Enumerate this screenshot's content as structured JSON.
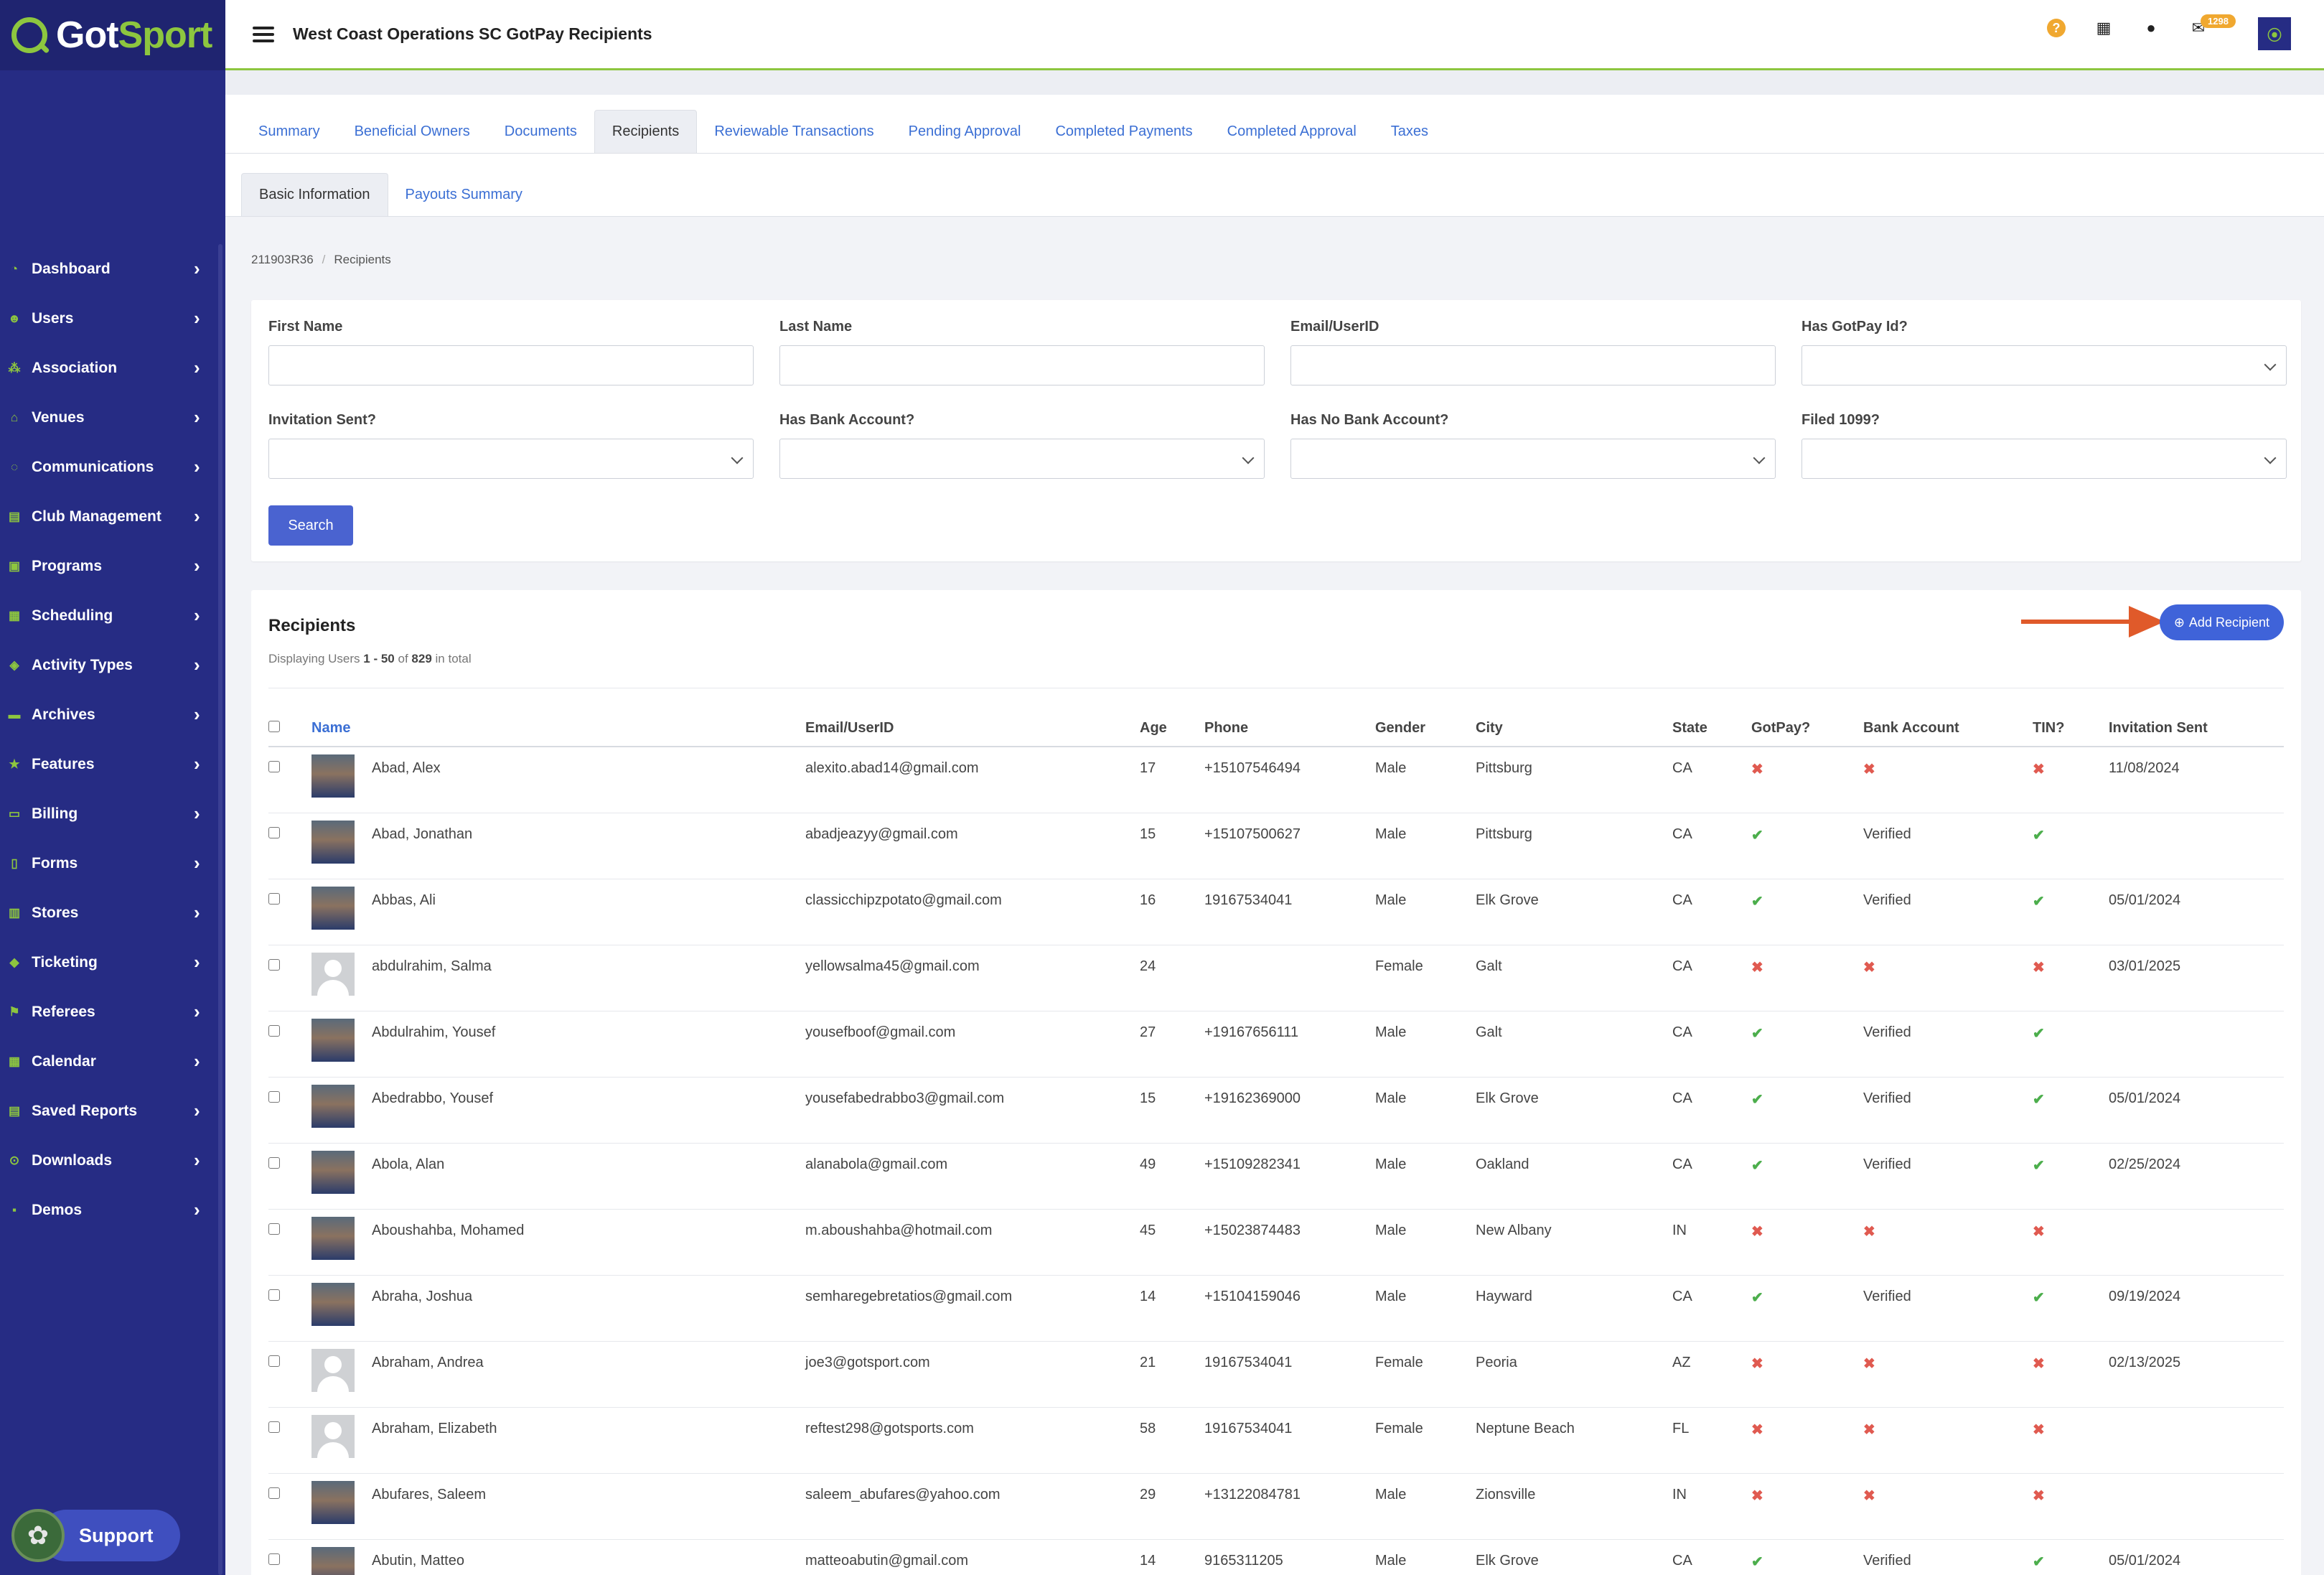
{
  "brand": {
    "got": "Got",
    "sport": "Sport"
  },
  "header": {
    "title": "West Coast Operations SC GotPay Recipients",
    "mail_count": "1298"
  },
  "sidebar": {
    "items": [
      {
        "label": "Dashboard",
        "icon": "dashboard-icon"
      },
      {
        "label": "Users",
        "icon": "users-icon"
      },
      {
        "label": "Association",
        "icon": "association-icon"
      },
      {
        "label": "Venues",
        "icon": "venues-icon"
      },
      {
        "label": "Communications",
        "icon": "communications-icon"
      },
      {
        "label": "Club Management",
        "icon": "club-management-icon"
      },
      {
        "label": "Programs",
        "icon": "programs-icon"
      },
      {
        "label": "Scheduling",
        "icon": "scheduling-icon"
      },
      {
        "label": "Activity Types",
        "icon": "activity-types-icon"
      },
      {
        "label": "Archives",
        "icon": "archives-icon"
      },
      {
        "label": "Features",
        "icon": "features-icon"
      },
      {
        "label": "Billing",
        "icon": "billing-icon"
      },
      {
        "label": "Forms",
        "icon": "forms-icon"
      },
      {
        "label": "Stores",
        "icon": "stores-icon"
      },
      {
        "label": "Ticketing",
        "icon": "ticketing-icon"
      },
      {
        "label": "Referees",
        "icon": "referees-icon"
      },
      {
        "label": "Calendar",
        "icon": "calendar-icon"
      },
      {
        "label": "Saved Reports",
        "icon": "saved-reports-icon"
      },
      {
        "label": "Downloads",
        "icon": "downloads-icon"
      },
      {
        "label": "Demos",
        "icon": "demos-icon"
      }
    ],
    "support_label": "Support"
  },
  "tabs": [
    "Summary",
    "Beneficial Owners",
    "Documents",
    "Recipients",
    "Reviewable Transactions",
    "Pending Approval",
    "Completed Payments",
    "Completed Approval",
    "Taxes"
  ],
  "active_tab": "Recipients",
  "subtabs": [
    "Basic Information",
    "Payouts Summary"
  ],
  "breadcrumb": {
    "code": "211903R36",
    "current": "Recipients"
  },
  "filters": {
    "first_name": {
      "label": "First Name",
      "value": ""
    },
    "last_name": {
      "label": "Last Name",
      "value": ""
    },
    "email": {
      "label": "Email/UserID",
      "value": ""
    },
    "has_gotpay": {
      "label": "Has GotPay Id?",
      "value": ""
    },
    "invitation_sent": {
      "label": "Invitation Sent?",
      "value": ""
    },
    "has_bank": {
      "label": "Has Bank Account?",
      "value": ""
    },
    "has_no_bank": {
      "label": "Has No Bank Account?",
      "value": ""
    },
    "filed_1099": {
      "label": "Filed 1099?",
      "value": ""
    },
    "search_label": "Search"
  },
  "recipients": {
    "title": "Recipients",
    "display_prefix": "Displaying Users",
    "range": "1 - 50",
    "of": "of",
    "total": "829",
    "suffix": "in total",
    "add_label": "Add Recipient",
    "columns": [
      "Name",
      "Email/UserID",
      "Age",
      "Phone",
      "Gender",
      "City",
      "State",
      "GotPay?",
      "Bank Account",
      "TIN?",
      "Invitation Sent"
    ],
    "rows": [
      {
        "name": "Abad, Alex",
        "email": "alexito.abad14@gmail.com",
        "age": "17",
        "phone": "+15107546494",
        "gender": "Male",
        "city": "Pittsburg",
        "state": "CA",
        "gotpay": false,
        "bank": "",
        "tin": false,
        "invited": "11/08/2024",
        "photo": true
      },
      {
        "name": "Abad, Jonathan",
        "email": "abadjeazyy@gmail.com",
        "age": "15",
        "phone": "+15107500627",
        "gender": "Male",
        "city": "Pittsburg",
        "state": "CA",
        "gotpay": true,
        "bank": "Verified",
        "tin": true,
        "invited": "",
        "photo": true
      },
      {
        "name": "Abbas, Ali",
        "email": "classicchipzpotato@gmail.com",
        "age": "16",
        "phone": "19167534041",
        "gender": "Male",
        "city": "Elk Grove",
        "state": "CA",
        "gotpay": true,
        "bank": "Verified",
        "tin": true,
        "invited": "05/01/2024",
        "photo": true
      },
      {
        "name": "abdulrahim, Salma",
        "email": "yellowsalma45@gmail.com",
        "age": "24",
        "phone": "",
        "gender": "Female",
        "city": "Galt",
        "state": "CA",
        "gotpay": false,
        "bank": "",
        "tin": false,
        "invited": "03/01/2025",
        "photo": false
      },
      {
        "name": "Abdulrahim, Yousef",
        "email": "yousefboof@gmail.com",
        "age": "27",
        "phone": "+19167656111",
        "gender": "Male",
        "city": "Galt",
        "state": "CA",
        "gotpay": true,
        "bank": "Verified",
        "tin": true,
        "invited": "",
        "photo": true
      },
      {
        "name": "Abedrabbo, Yousef",
        "email": "yousefabedrabbo3@gmail.com",
        "age": "15",
        "phone": "+19162369000",
        "gender": "Male",
        "city": "Elk Grove",
        "state": "CA",
        "gotpay": true,
        "bank": "Verified",
        "tin": true,
        "invited": "05/01/2024",
        "photo": true
      },
      {
        "name": "Abola, Alan",
        "email": "alanabola@gmail.com",
        "age": "49",
        "phone": "+15109282341",
        "gender": "Male",
        "city": "Oakland",
        "state": "CA",
        "gotpay": true,
        "bank": "Verified",
        "tin": true,
        "invited": "02/25/2024",
        "photo": true
      },
      {
        "name": "Aboushahba, Mohamed",
        "email": "m.aboushahba@hotmail.com",
        "age": "45",
        "phone": "+15023874483",
        "gender": "Male",
        "city": "New Albany",
        "state": "IN",
        "gotpay": false,
        "bank": "",
        "tin": false,
        "invited": "",
        "photo": true
      },
      {
        "name": "Abraha, Joshua",
        "email": "semharegebretatios@gmail.com",
        "age": "14",
        "phone": "+15104159046",
        "gender": "Male",
        "city": "Hayward",
        "state": "CA",
        "gotpay": true,
        "bank": "Verified",
        "tin": true,
        "invited": "09/19/2024",
        "photo": true
      },
      {
        "name": "Abraham, Andrea",
        "email": "joe3@gotsport.com",
        "age": "21",
        "phone": "19167534041",
        "gender": "Female",
        "city": "Peoria",
        "state": "AZ",
        "gotpay": false,
        "bank": "",
        "tin": false,
        "invited": "02/13/2025",
        "photo": false
      },
      {
        "name": "Abraham, Elizabeth",
        "email": "reftest298@gotsports.com",
        "age": "58",
        "phone": "19167534041",
        "gender": "Female",
        "city": "Neptune Beach",
        "state": "FL",
        "gotpay": false,
        "bank": "",
        "tin": false,
        "invited": "",
        "photo": false
      },
      {
        "name": "Abufares, Saleem",
        "email": "saleem_abufares@yahoo.com",
        "age": "29",
        "phone": "+13122084781",
        "gender": "Male",
        "city": "Zionsville",
        "state": "IN",
        "gotpay": false,
        "bank": "",
        "tin": false,
        "invited": "",
        "photo": true
      },
      {
        "name": "Abutin, Matteo",
        "email": "matteoabutin@gmail.com",
        "age": "14",
        "phone": "9165311205",
        "gender": "Male",
        "city": "Elk Grove",
        "state": "CA",
        "gotpay": true,
        "bank": "Verified",
        "tin": true,
        "invited": "05/01/2024",
        "photo": true
      }
    ]
  },
  "colors": {
    "sidebar": "#262c84",
    "accent_green": "#8dc63f",
    "link_blue": "#3b6fd4",
    "button_blue": "#4a63d0",
    "arrow": "#e05a2a",
    "cross": "#e05a50",
    "check": "#4cae4c"
  }
}
